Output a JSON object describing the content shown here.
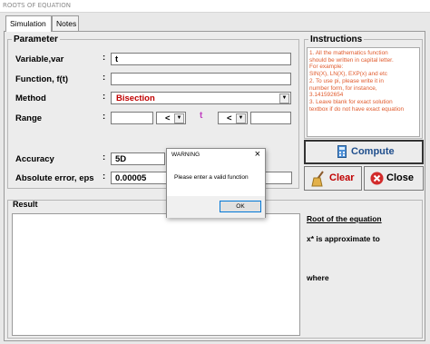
{
  "window": {
    "title": "ROOTS OF EQUATION"
  },
  "tabs": [
    {
      "label": "Simulation"
    },
    {
      "label": "Notes"
    }
  ],
  "parameter": {
    "title": "Parameter",
    "variable_label": "Variable,var",
    "variable_value": "t",
    "function_label": "Function, f(t)",
    "function_value": "",
    "method_label": "Method",
    "method_value": "Bisection",
    "range_label": "Range",
    "range_lower": "",
    "range_op1": "<",
    "range_var": "t",
    "range_op2": "<",
    "range_upper": "",
    "accuracy_label": "Accuracy",
    "accuracy_value": "5D",
    "abs_error_label": "Absolute error, eps",
    "abs_error_value": "0.00005"
  },
  "instructions": {
    "title": "Instructions",
    "lines": [
      "1. All the mathematics function",
      "should be written in capital letter.",
      "For example:",
      "SIN(X), LN(X), EXP(x) and etc",
      "2. To use pi, please write it in",
      "number form, for instance,",
      "3.141592654",
      "3. Leave blank for exact solution",
      "textbox if do not have exact equation"
    ]
  },
  "buttons": {
    "compute": "Compute",
    "clear": "Clear",
    "close": "Close"
  },
  "result": {
    "title": "Result",
    "value": ""
  },
  "root": {
    "title": "Root of the equation",
    "approx": "x* is approximate to",
    "where": "where"
  },
  "dialog": {
    "title": "WARNING",
    "message": "Please enter a valid function",
    "ok": "OK",
    "close": "×"
  },
  "colors": {
    "accent_red": "#c00000",
    "instruction_text": "#e05a2c",
    "range_var": "#c03ec0"
  }
}
